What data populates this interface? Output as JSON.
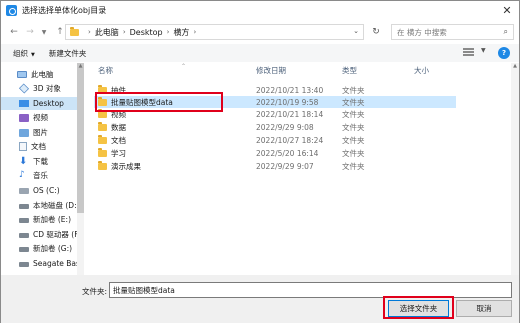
{
  "window": {
    "title": "选择选择单体化obj目录",
    "close_glyph": "✕"
  },
  "address": {
    "crumbs": [
      "此电脑",
      "Desktop",
      "横方"
    ],
    "search_placeholder": "在 横方 中搜索"
  },
  "toolbar": {
    "organize": "组织",
    "new_folder": "新建文件夹"
  },
  "sidebar": {
    "items": [
      {
        "label": "此电脑",
        "icon": "pc-icon"
      },
      {
        "label": "3D 对象",
        "icon": "3d-objects-icon"
      },
      {
        "label": "Desktop",
        "icon": "desktop-icon"
      },
      {
        "label": "视频",
        "icon": "video-icon"
      },
      {
        "label": "图片",
        "icon": "pictures-icon"
      },
      {
        "label": "文档",
        "icon": "documents-icon"
      },
      {
        "label": "下载",
        "icon": "download-icon"
      },
      {
        "label": "音乐",
        "icon": "music-icon"
      },
      {
        "label": "OS (C:)",
        "icon": "os-drive-icon"
      },
      {
        "label": "本地磁盘 (D:)",
        "icon": "drive-icon"
      },
      {
        "label": "新加卷 (E:)",
        "icon": "drive-icon"
      },
      {
        "label": "CD 驱动器 (F",
        "icon": "cd-drive-icon"
      },
      {
        "label": "新加卷 (G:)",
        "icon": "drive-icon"
      },
      {
        "label": "Seagate Bas",
        "icon": "drive-icon"
      }
    ],
    "selected_index": 2
  },
  "filelist": {
    "columns": {
      "name": "名称",
      "date": "修改日期",
      "type": "类型",
      "size": "大小"
    },
    "rows": [
      {
        "name": "抽件",
        "date": "2022/10/21 13:40",
        "type": "文件夹"
      },
      {
        "name": "批量贴图模型data",
        "date": "2022/10/19 9:58",
        "type": "文件夹"
      },
      {
        "name": "视频",
        "date": "2022/10/21 18:14",
        "type": "文件夹"
      },
      {
        "name": "数据",
        "date": "2022/9/29 9:08",
        "type": "文件夹"
      },
      {
        "name": "文档",
        "date": "2022/10/27 18:24",
        "type": "文件夹"
      },
      {
        "name": "学习",
        "date": "2022/5/20 16:14",
        "type": "文件夹"
      },
      {
        "name": "演示成果",
        "date": "2022/9/29 9:07",
        "type": "文件夹"
      }
    ],
    "selected_index": 1
  },
  "bottom": {
    "filename_label": "文件夹:",
    "filename_value": "批量贴图模型data",
    "select_button": "选择文件夹",
    "cancel_button": "取消"
  },
  "colors": {
    "accent": "#0078d7",
    "selection": "#cce8ff",
    "highlight": "#e0001b",
    "folder": "#f5c344"
  }
}
